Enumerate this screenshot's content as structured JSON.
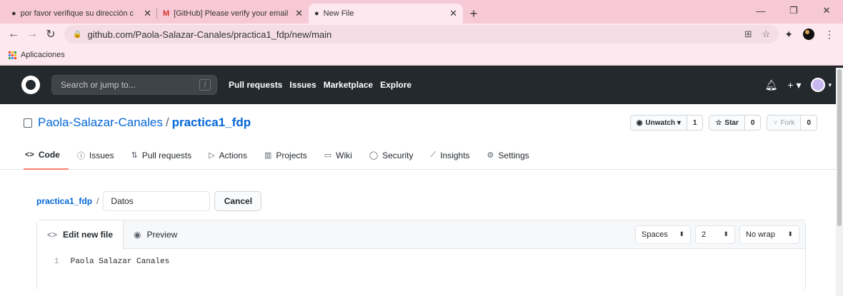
{
  "browser": {
    "tabs": [
      {
        "title": "por favor verifique su dirección c",
        "icon": "github-icon"
      },
      {
        "title": "[GitHub] Please verify your email",
        "icon": "gmail-icon"
      },
      {
        "title": "New File",
        "icon": "github-icon"
      }
    ],
    "url": "github.com/Paola-Salazar-Canales/practica1_fdp/new/main",
    "bookmarks": {
      "apps_label": "Aplicaciones"
    }
  },
  "github": {
    "search_placeholder": "Search or jump to...",
    "search_key": "/",
    "nav": [
      "Pull requests",
      "Issues",
      "Marketplace",
      "Explore"
    ]
  },
  "repo": {
    "owner": "Paola-Salazar-Canales",
    "name": "practica1_fdp",
    "watch": {
      "label": "Unwatch ▾",
      "count": "1"
    },
    "star": {
      "label": "Star",
      "count": "0"
    },
    "fork": {
      "label": "Fork",
      "count": "0"
    },
    "tabs": [
      {
        "label": "Code",
        "icon": "<>"
      },
      {
        "label": "Issues",
        "icon": "ⓘ"
      },
      {
        "label": "Pull requests",
        "icon": "⇅"
      },
      {
        "label": "Actions",
        "icon": "▷"
      },
      {
        "label": "Projects",
        "icon": "▥"
      },
      {
        "label": "Wiki",
        "icon": "▭"
      },
      {
        "label": "Security",
        "icon": "◯"
      },
      {
        "label": "Insights",
        "icon": "⟋"
      },
      {
        "label": "Settings",
        "icon": "⚙"
      }
    ]
  },
  "editor": {
    "path_root": "practica1_fdp",
    "filename": "Datos",
    "cancel": "Cancel",
    "tab_edit": "Edit new file",
    "tab_preview": "Preview",
    "indent_mode": "Spaces",
    "indent_size": "2",
    "wrap_mode": "No wrap",
    "lines": [
      {
        "n": "1",
        "text": "Paola Salazar Canales"
      }
    ]
  }
}
